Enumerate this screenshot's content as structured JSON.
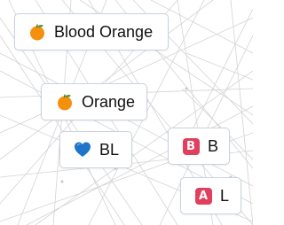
{
  "canvas": {
    "background": "#ffffff",
    "line_color": "#d4d4d4"
  },
  "elements": [
    {
      "id": "blood-orange",
      "label": "Blood Orange",
      "icon": "tangerine-emoji"
    },
    {
      "id": "orange",
      "label": "Orange",
      "icon": "tangerine-emoji"
    },
    {
      "id": "bl",
      "label": "BL",
      "icon": "blue-heart-emoji"
    },
    {
      "id": "b",
      "label": "B",
      "icon": "b-button-emoji",
      "badge_letter": "B"
    },
    {
      "id": "l",
      "label": "L",
      "icon": "a-button-emoji",
      "badge_letter": "A"
    }
  ],
  "colors": {
    "chip_border": "#c9d3dc",
    "orange_fruit": "#f4900c",
    "leaf_green": "#5c913b",
    "heart_blue": "#1f74c9",
    "badge_red": "#e0405e"
  }
}
